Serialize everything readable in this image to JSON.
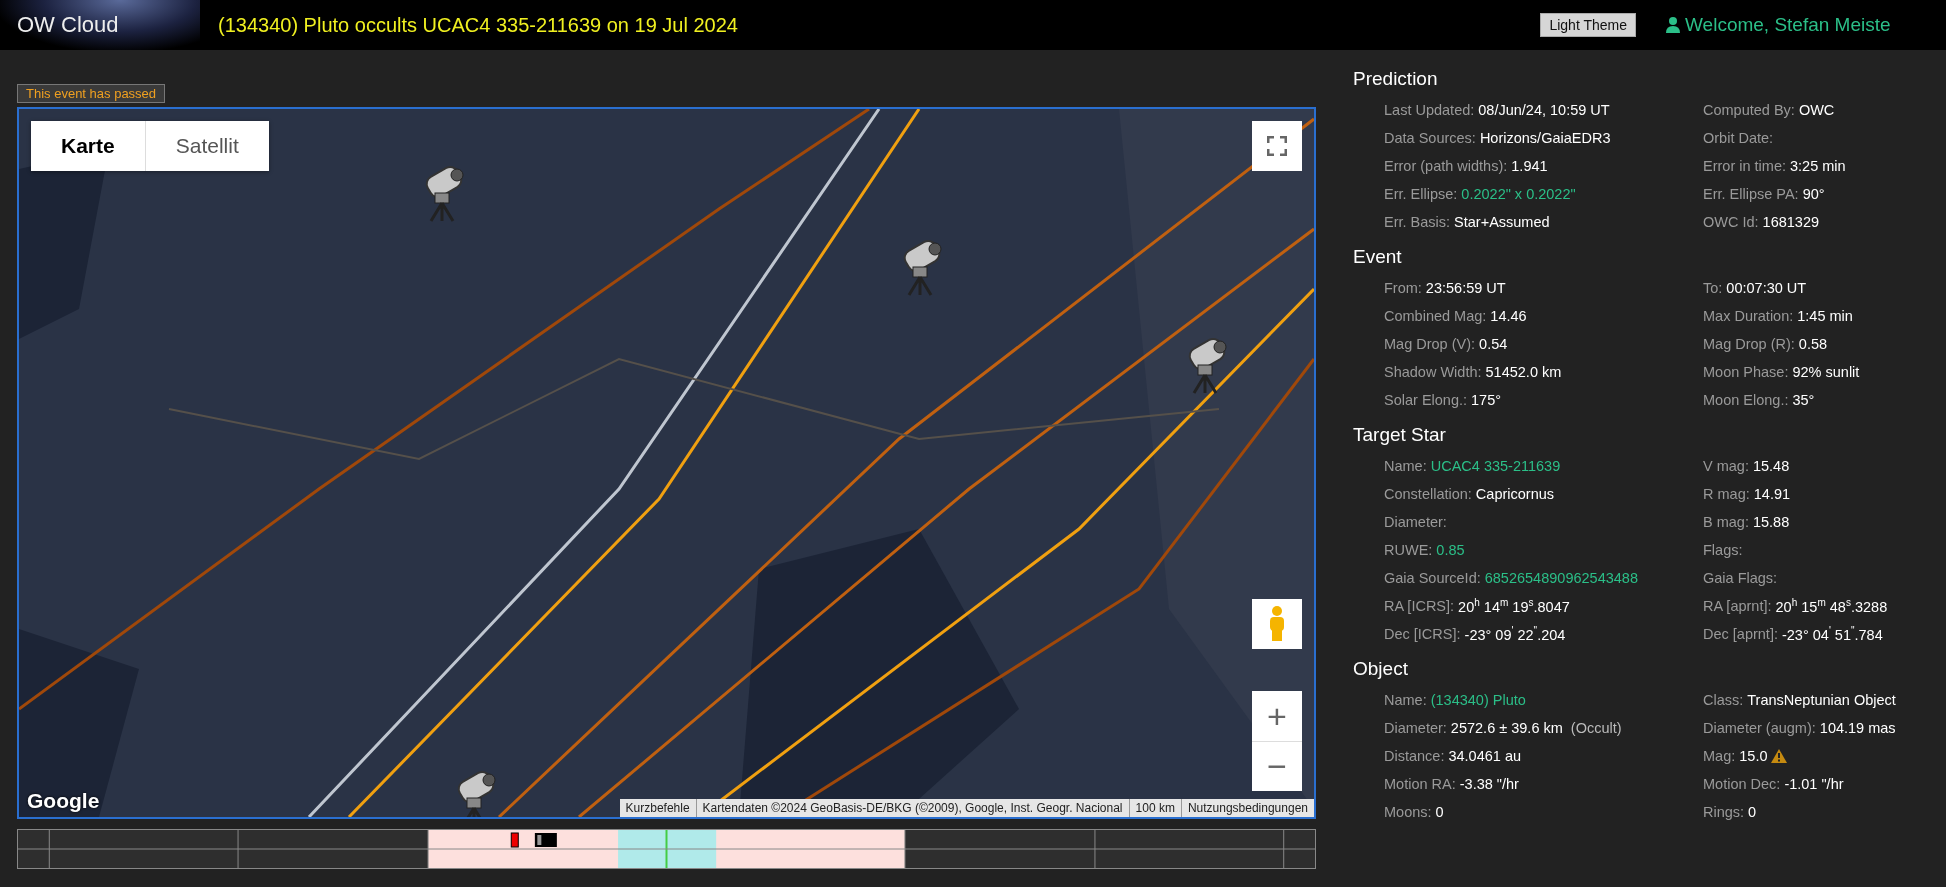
{
  "header": {
    "logo": "OW Cloud",
    "title": "(134340) Pluto occults UCAC4 335-211639 on 19 Jul 2024",
    "theme_button": "Light Theme",
    "welcome": "Welcome, Stefan Meiste"
  },
  "banner": "This event has passed",
  "map": {
    "map_types": [
      {
        "label": "Karte",
        "selected": true
      },
      {
        "label": "Satellit",
        "selected": false
      }
    ],
    "logo": "Google",
    "attribution": [
      "Kurzbefehle",
      "Kartendaten ©2024 GeoBasis-DE/BKG (©2009), Google, Inst. Geogr. Nacional",
      "100 km",
      "Nutzungsbedingungen"
    ],
    "zoom_in": "+",
    "zoom_out": "−"
  },
  "sections": [
    {
      "title": "Prediction",
      "rows": [
        [
          {
            "label": "Last Updated:",
            "value": "08/Jun/24, 10:59 UT"
          },
          {
            "label": "Computed By:",
            "value": "OWC"
          }
        ],
        [
          {
            "label": "Data Sources:",
            "value": "Horizons/GaiaEDR3"
          },
          {
            "label": "Orbit Date:"
          }
        ],
        [
          {
            "label": "Error (path widths):",
            "value": "1.941"
          },
          {
            "label": "Error in time:",
            "value": "3:25 min"
          }
        ],
        [
          {
            "label": "Err. Ellipse:",
            "value": "0.2022\" x 0.2022\"",
            "link": true
          },
          {
            "label": "Err. Ellipse PA:",
            "value": "90°"
          }
        ],
        [
          {
            "label": "Err. Basis:",
            "value": "Star+Assumed"
          },
          {
            "label": "OWC Id:",
            "value": "1681329"
          }
        ]
      ]
    },
    {
      "title": "Event",
      "rows": [
        [
          {
            "label": "From:",
            "value": "23:56:59 UT"
          },
          {
            "label": "To:",
            "value": "00:07:30 UT"
          }
        ],
        [
          {
            "label": "Combined Mag:",
            "value": "14.46"
          },
          {
            "label": "Max Duration:",
            "value": "1:45 min"
          }
        ],
        [
          {
            "label": "Mag Drop (V):",
            "value": "0.54"
          },
          {
            "label": "Mag Drop (R):",
            "value": "0.58"
          }
        ],
        [
          {
            "label": "Shadow Width:",
            "value": "51452.0 km"
          },
          {
            "label": "Moon Phase:",
            "value": "92% sunlit"
          }
        ],
        [
          {
            "label": "Solar Elong.:",
            "value": "175°"
          },
          {
            "label": "Moon Elong.:",
            "value": "35°"
          }
        ]
      ]
    },
    {
      "title": "Target Star",
      "rows": [
        [
          {
            "label": "Name:",
            "value": "UCAC4 335-211639",
            "link": true
          },
          {
            "label": "V mag:",
            "value": "15.48"
          }
        ],
        [
          {
            "label": "Constellation:",
            "value": "Capricornus"
          },
          {
            "label": "R mag:",
            "value": "14.91"
          }
        ],
        [
          {
            "label": "Diameter:"
          },
          {
            "label": "B mag:",
            "value": "15.88"
          }
        ],
        [
          {
            "label": "RUWE:",
            "value": "0.85",
            "link": true
          },
          {
            "label": "Flags:"
          }
        ],
        [
          {
            "label": "Gaia SourceId:",
            "value": "6852654890962543488",
            "link": true
          },
          {
            "label": "Gaia Flags:"
          }
        ],
        [
          {
            "label": "RA [ICRS]:",
            "value": "20$^{h}$ 14$^{m}$ 19$^{s}$.8047"
          },
          {
            "label": "RA [aprnt]:",
            "value": "20$^{h}$ 15$^{m}$ 48$^{s}$.3288"
          }
        ],
        [
          {
            "label": "Dec [ICRS]:",
            "value": "-23° 09$^{'}$ 22$^{\"}$.204"
          },
          {
            "label": "Dec [aprnt]:",
            "value": "-23° 04$^{'}$ 51$^{\"}$.784"
          }
        ]
      ]
    },
    {
      "title": "Object",
      "rows": [
        [
          {
            "label": "Name:",
            "value": "(134340) Pluto",
            "link": true
          },
          {
            "label": "Class:",
            "value": "TransNeptunian Object"
          }
        ],
        [
          {
            "label": "Diameter:",
            "value": "2572.6 ± 39.6 km",
            "note": "(Occult)"
          },
          {
            "label": "Diameter (augm):",
            "value": "104.19 mas"
          }
        ],
        [
          {
            "label": "Distance:",
            "value": "34.0461 au"
          },
          {
            "label": "Mag:",
            "value": "15.0",
            "warning": true
          }
        ],
        [
          {
            "label": "Motion RA:",
            "value": "-3.38 \"/hr"
          },
          {
            "label": "Motion Dec:",
            "value": "-1.01 \"/hr"
          }
        ],
        [
          {
            "label": "Moons:",
            "value": "0"
          },
          {
            "label": "Rings:",
            "value": "0"
          }
        ]
      ]
    }
  ]
}
